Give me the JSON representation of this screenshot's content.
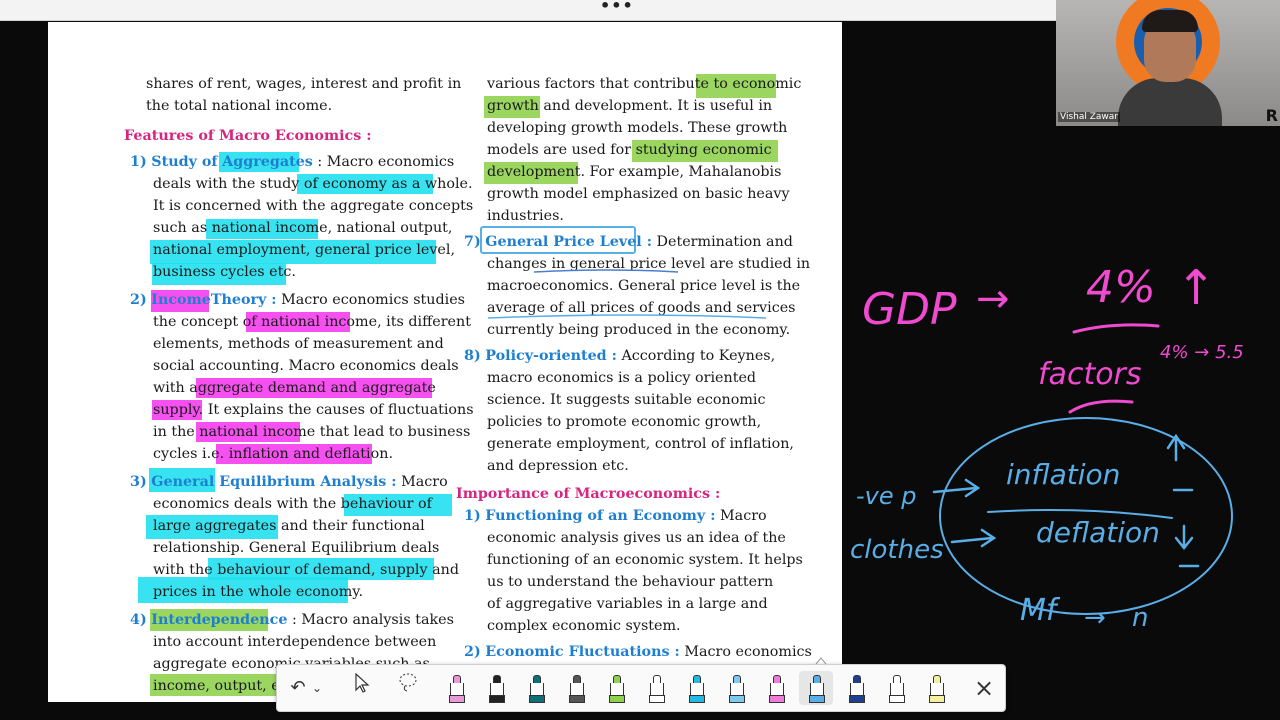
{
  "window": {
    "menu_dots": "•••"
  },
  "doc": {
    "left_col": {
      "intro_1": "shares of rent, wages, interest and profit  in",
      "intro_2": "the total national income.",
      "features_title": "Features of Macro Economics :",
      "items": [
        {
          "num": "1)",
          "title": "Study of",
          "title_hl": "Aggregates",
          "lines": [
            ": Macro economics",
            "deals with the study of",
            "economy as a whole.",
            "It is concerned with the aggregate concepts",
            "such as",
            "national income",
            ", national output,",
            "national employment, general price level,",
            "business cycles etc."
          ]
        },
        {
          "num": "2)",
          "title": "Income",
          "title2": "Theory :",
          "lines": [
            "Macro economics studies",
            "the concept of",
            "national income",
            ", its different",
            "elements,  methods  of  measurement  and",
            "social accounting. Macro economics deals",
            "with  aggregate  demand  and  aggregate",
            "supply.",
            " It explains the causes of fluctuations",
            "in the",
            "national income",
            " that lead to business",
            "cycles i.e.",
            "inflation and deflation."
          ]
        },
        {
          "num": "3)",
          "title": "General Equilibrium Analysis :",
          "lines": [
            "Macro",
            "economics   deals  with  the",
            "behaviour  of",
            "large  aggregates",
            "  and  their  functional",
            "relationship.  General  Equilibrium  deals",
            "with the behaviour of demand, supply and",
            "prices in the whole economy."
          ]
        },
        {
          "num": "4)",
          "title": "Interdependence",
          "lines": [
            ": Macro analysis takes",
            "into  account   interdependence   between",
            "aggregate  economic  variables  such  as",
            "income, output, em"
          ]
        }
      ]
    },
    "right_col": {
      "l1a": "various factors that contribute to",
      "l1b": "economic",
      "l2a": "growth",
      "l2b": " and development.  It is   useful in",
      "l3": "developing growth models. These growth",
      "l4a": "models   are   used   for",
      "l4b": "studying  economic",
      "l5a": "development.",
      "l5b": " For example, Mahalanobis",
      "l6": "growth model emphasized on basic heavy",
      "l7": "industries.",
      "i7_num": "7)",
      "i7_title": "General Price Level :",
      "i7_a": " Determination  and",
      "i7_b": "changes in general price level are studied in",
      "i7_c": "macroeconomics. General price level is the",
      "i7_d": "average of all prices of goods and services",
      "i7_e": "currently being produced in the economy.",
      "i8_num": "8)",
      "i8_title": "Policy-oriented :",
      "i8_a": " According to Keynes,",
      "i8_b": "macro   economics   is   a   policy   oriented",
      "i8_c": "science.    It    suggests    suitable    economic",
      "i8_d": "policies   to   promote   economic   growth,",
      "i8_e": "generate  employment,  control  of  inflation,",
      "i8_f": "and depression etc.",
      "imp_title": "Importance of Macroeconomics :",
      "p1_num": "1)",
      "p1_title": "Functioning   of   an   Economy   :",
      "p1_a": " Macro",
      "p1_b": "economic analysis gives us an idea of the",
      "p1_c": "functioning of an economic system. It helps",
      "p1_d": "us  to  understand  the  behaviour  pattern",
      "p1_e": "of  aggregative  variables  in  a  large  and",
      "p1_f": "complex economic system.",
      "p2_num": "2)",
      "p2_title": "Economic Fluctuations :",
      "p2_a": " Macro economics"
    }
  },
  "webcam": {
    "presenter_name": "Vishal Zawar",
    "badge_letter": "R"
  },
  "handwriting": {
    "gdp": "GDP",
    "arrow1": "→",
    "pct": "4%",
    "up": "↑",
    "factors": "factors",
    "range": "4% → 5.5",
    "vep": "-ve p",
    "inflation": "inflation",
    "deflation": "deflation",
    "clo": "clothes",
    "mf": "Mf",
    "arrow2": "→",
    "n": "n"
  },
  "toolbar": {
    "undo": "↶",
    "undo_menu": "⌄",
    "select": "cursor-icon",
    "lasso": "lasso-icon",
    "pens": [
      {
        "name": "eraser",
        "color": "#e89ad8"
      },
      {
        "name": "pen-black",
        "color": "#222222"
      },
      {
        "name": "pen-teal",
        "color": "#0f6f78"
      },
      {
        "name": "pen-gray",
        "color": "#555555"
      },
      {
        "name": "highlighter-green",
        "color": "#8fd14f"
      },
      {
        "name": "pen-white",
        "color": "#ffffff"
      },
      {
        "name": "pen-cyan",
        "color": "#25b8e0"
      },
      {
        "name": "pen-lightblue",
        "color": "#7fc8f0"
      },
      {
        "name": "pen-pink",
        "color": "#f07ad8"
      },
      {
        "name": "pen-blue-selected",
        "color": "#5aaee8"
      },
      {
        "name": "pen-navy",
        "color": "#1f3f8f"
      },
      {
        "name": "pen-white2",
        "color": "#ffffff"
      },
      {
        "name": "highlighter-yellow",
        "color": "#f4f0a0"
      }
    ],
    "close": "×"
  }
}
